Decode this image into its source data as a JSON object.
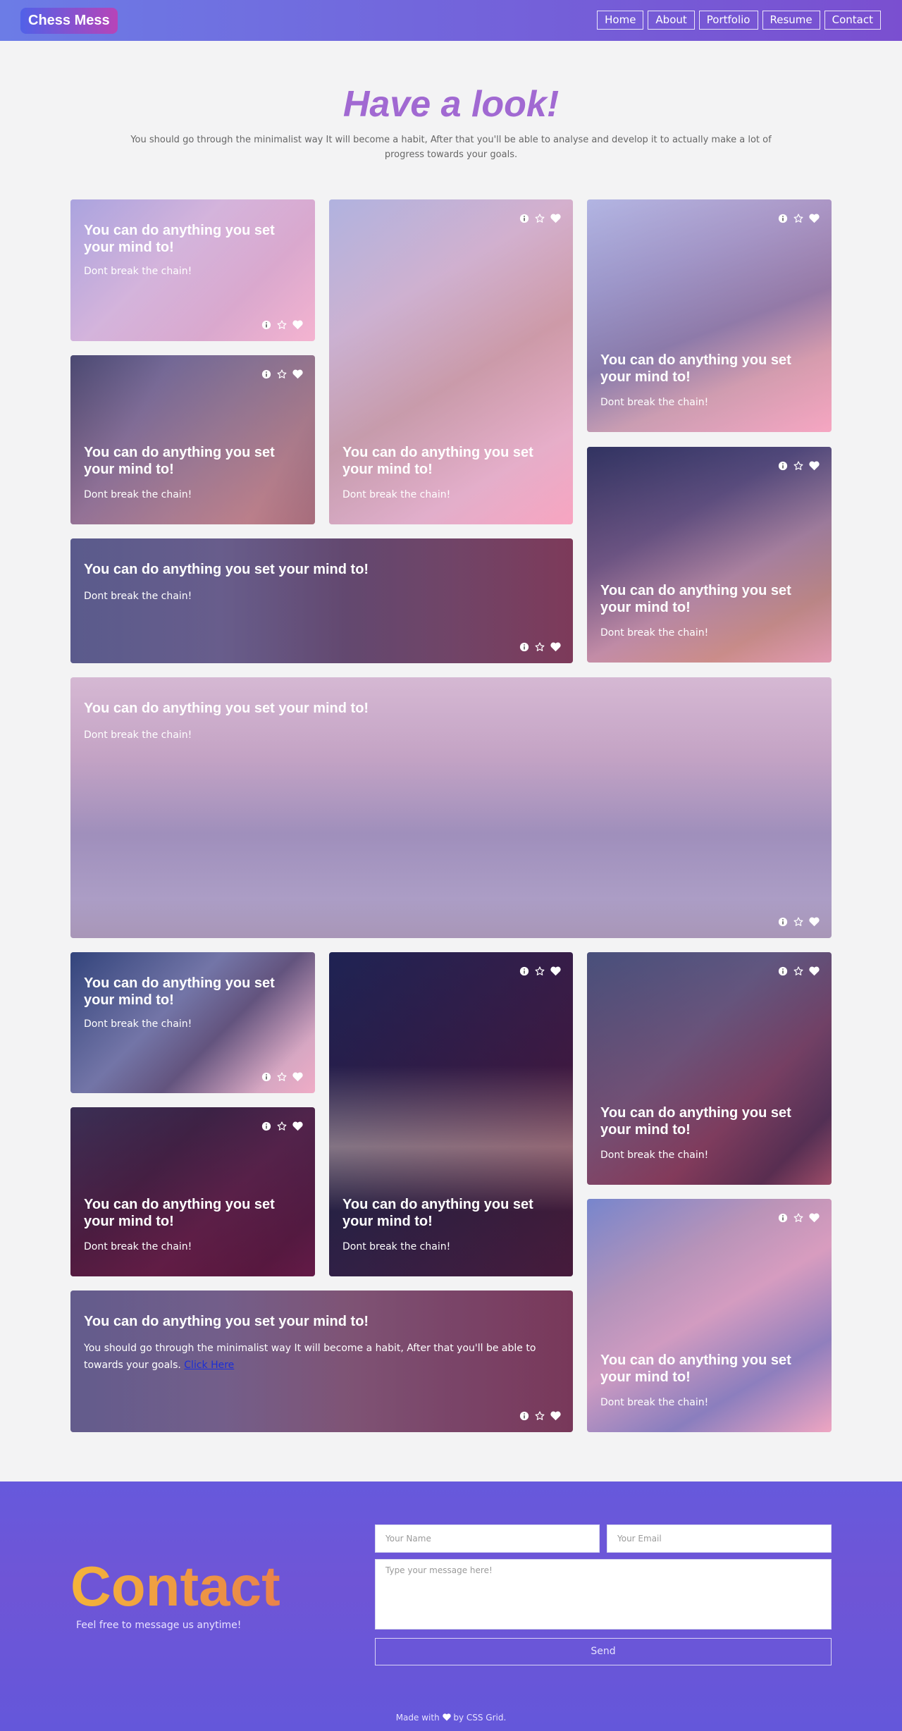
{
  "nav": {
    "logo": "Chess Mess",
    "links": [
      "Home",
      "About",
      "Portfolio",
      "Resume",
      "Contact"
    ]
  },
  "hero": {
    "title": "Have a look!",
    "intro": "You should go through the minimalist way It will become a habit, After that you'll be able to analyse and develop it to actually make a lot of progress towards your goals."
  },
  "cards": {
    "heading": "You can do anything you set your mind to!",
    "subtitle": "Dont break the chain!",
    "long_text": "You should go through the minimalist way It will become a habit, After that you'll be able to towards your goals.",
    "link_label": "Click Here",
    "icon_names": [
      "info-circle-icon",
      "star-outline-icon",
      "heart-icon"
    ]
  },
  "contact": {
    "title": "Contact",
    "subtitle": "Feel free to message us anytime!",
    "name_placeholder": "Your Name",
    "email_placeholder": "Your Email",
    "message_placeholder": "Type your message here!",
    "send_label": "Send"
  },
  "footer": {
    "made_with": "Made with",
    "by": "by CSS Grid."
  },
  "colors": {
    "nav_gradient": [
      "#6c7ce6",
      "#7a4fd0"
    ],
    "title_purple": "#a169d2",
    "contact_bg": "#6659dc",
    "contact_title": "#f0a83c"
  }
}
